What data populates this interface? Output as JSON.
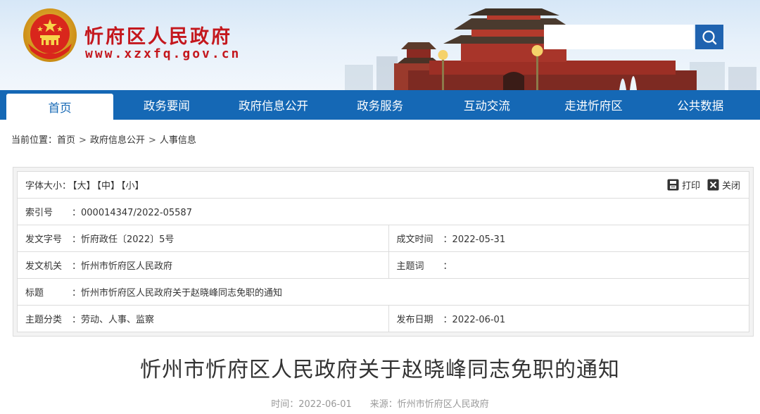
{
  "header": {
    "site_title": "忻府区人民政府",
    "site_url": "www.xzxfq.gov.cn",
    "search": {
      "value": "",
      "placeholder": ""
    },
    "search_icon": "search-icon"
  },
  "nav": {
    "items": [
      {
        "label": "首页",
        "active": true
      },
      {
        "label": "政务要闻"
      },
      {
        "label": "政府信息公开"
      },
      {
        "label": "政务服务"
      },
      {
        "label": "互动交流"
      },
      {
        "label": "走进忻府区"
      },
      {
        "label": "公共数据"
      }
    ]
  },
  "breadcrumb": {
    "prefix": "当前位置：",
    "items": [
      "首页",
      "政府信息公开",
      "人事信息"
    ],
    "separator": ">"
  },
  "info": {
    "font_size_label": "字体大小：",
    "font_sizes": [
      "【大】",
      "【中】",
      "【小】"
    ],
    "print_label": "打印",
    "close_label": "关闭",
    "colon": "：",
    "index_label": "索引号",
    "index_value": "000014347/2022-05587",
    "doc_no_label": "发文字号",
    "doc_no_value": "忻府政任〔2022〕5号",
    "created_label": "成文时间",
    "created_value": "2022-05-31",
    "issuer_label": "发文机关",
    "issuer_value": "忻州市忻府区人民政府",
    "topic_word_label": "主题词",
    "topic_word_value": "",
    "title_label": "标题",
    "title_value": "忻州市忻府区人民政府关于赵晓峰同志免职的通知",
    "category_label": "主题分类",
    "category_value": "劳动、人事、监察",
    "publish_label": "发布日期",
    "publish_value": "2022-06-01"
  },
  "article": {
    "title": "忻州市忻府区人民政府关于赵晓峰同志免职的通知",
    "time_label": "时间：",
    "time_value": "2022-06-01",
    "source_label": "来源：",
    "source_value": "忻州市忻府区人民政府"
  },
  "colors": {
    "brand_red": "#c4171d",
    "nav_blue": "#1568b5",
    "search_blue": "#1f63b0"
  }
}
